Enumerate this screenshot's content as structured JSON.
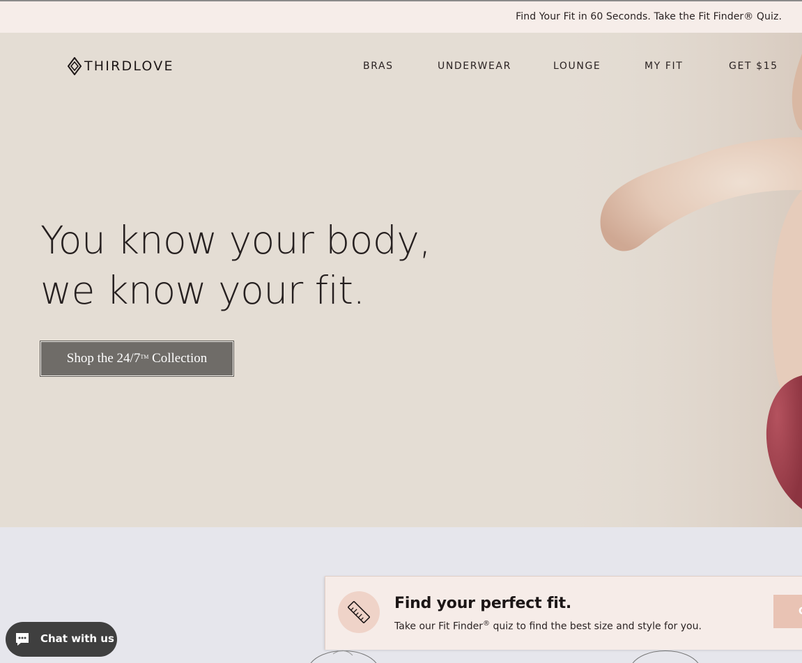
{
  "announcement": {
    "text": "Find Your Fit in 60 Seconds. Take the Fit Finder® Quiz."
  },
  "header": {
    "logo_text": "THIRDLOVE",
    "nav": [
      {
        "label": "BRAS"
      },
      {
        "label": "UNDERWEAR"
      },
      {
        "label": "LOUNGE"
      },
      {
        "label": "MY FIT"
      },
      {
        "label": "GET $15"
      }
    ]
  },
  "hero": {
    "headline_line1": "You know your body,",
    "headline_line2": "we know your fit.",
    "cta": {
      "text_before": "Shop the 24/7",
      "tm": "TM",
      "text_after": " Collection"
    }
  },
  "fit_banner": {
    "title": "Find your perfect fit.",
    "subtitle_before": "Take our Fit Finder",
    "subtitle_reg": "®",
    "subtitle_after": " quiz to find the best size and style for you.",
    "button_label": "C",
    "icon": "ruler-icon"
  },
  "chat": {
    "label": "Chat with us",
    "icon": "chat-bubble-icon"
  },
  "colors": {
    "announcement_bg": "#f6ede9",
    "hero_bg": "#e4ddd4",
    "cta_bg": "#6f6c68",
    "banner_bg": "#f6ece8",
    "banner_icon_bg": "#efd3c8",
    "banner_button_bg": "#e9c3b4",
    "lower_bg": "#e6e6ec",
    "chat_bg": "#3f3f3f",
    "garment": "#a84350"
  }
}
